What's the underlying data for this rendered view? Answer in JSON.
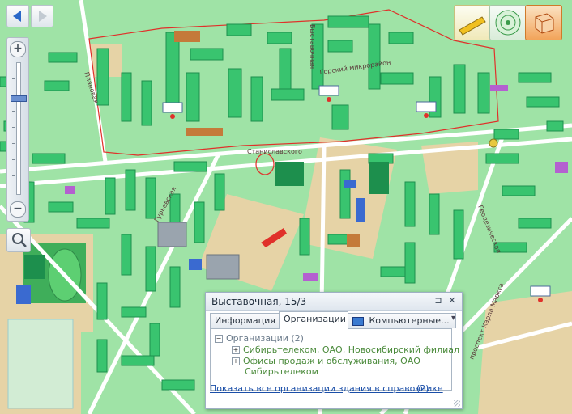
{
  "map": {
    "street_labels": [
      "Выставочная",
      "Плановая",
      "Гурьевская",
      "Геодезическая",
      "проспект Карла Маркса",
      "Станиславского",
      "Горский микрорайон"
    ],
    "colors": {
      "ground": "#9fe3a6",
      "building_green": "#39c46f",
      "building_dark": "#1d8f4d",
      "block": "#e6d3a6",
      "road": "#ffffff",
      "boundary": "#e0302a",
      "highlight": "#e0302a"
    }
  },
  "nav": {
    "back_icon": "arrow-left-icon",
    "forward_icon": "arrow-right-icon"
  },
  "zoom": {
    "plus": "+",
    "minus": "−",
    "level_fraction": 0.27
  },
  "popup": {
    "title": "Выставочная, 15/3",
    "pin_glyph": "⊐",
    "close_glyph": "✕",
    "tabs": [
      {
        "label": "Информация",
        "active": false
      },
      {
        "label": "Организации",
        "active": true
      },
      {
        "label": "Компьютерные...",
        "active": false
      }
    ],
    "tabs_overflow": "▾",
    "tree": {
      "root": "Организации (2)",
      "items": [
        "Сибирьтелеком, ОАО, Новосибирский филиал",
        "Офисы продаж и обслуживания, ОАО",
        "Сибирьтелеком"
      ]
    },
    "show_all_link": "Показать все организации здания в справочнике",
    "show_all_count": "(2)"
  }
}
